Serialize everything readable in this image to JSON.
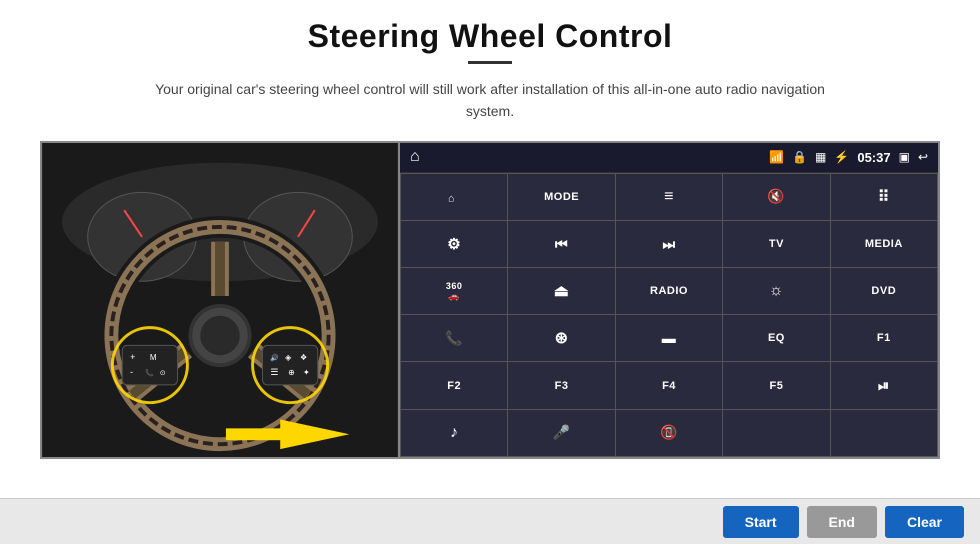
{
  "page": {
    "title": "Steering Wheel Control",
    "subtitle": "Your original car's steering wheel control will still work after installation of this all-in-one auto radio navigation system."
  },
  "topbar": {
    "time": "05:37"
  },
  "buttons": [
    {
      "id": "b1",
      "type": "icon",
      "icon": "navigate-icon",
      "symbol": "⌂"
    },
    {
      "id": "b2",
      "type": "text",
      "label": "MODE"
    },
    {
      "id": "b3",
      "type": "icon",
      "icon": "list-icon",
      "symbol": "≡"
    },
    {
      "id": "b4",
      "type": "icon",
      "icon": "mute-icon",
      "symbol": "🔇"
    },
    {
      "id": "b5",
      "type": "icon",
      "icon": "apps-icon",
      "symbol": "⠿"
    },
    {
      "id": "b6",
      "type": "icon",
      "icon": "settings-icon",
      "symbol": "⚙"
    },
    {
      "id": "b7",
      "type": "icon",
      "icon": "prev-icon",
      "symbol": "⏮"
    },
    {
      "id": "b8",
      "type": "icon",
      "icon": "next-icon",
      "symbol": "⏭"
    },
    {
      "id": "b9",
      "type": "text",
      "label": "TV"
    },
    {
      "id": "b10",
      "type": "text",
      "label": "MEDIA"
    },
    {
      "id": "b11",
      "type": "icon",
      "icon": "camera360-icon",
      "symbol": "360"
    },
    {
      "id": "b12",
      "type": "icon",
      "icon": "eject-icon",
      "symbol": "⏏"
    },
    {
      "id": "b13",
      "type": "text",
      "label": "RADIO"
    },
    {
      "id": "b14",
      "type": "icon",
      "icon": "brightness-icon",
      "symbol": "☼"
    },
    {
      "id": "b15",
      "type": "text",
      "label": "DVD"
    },
    {
      "id": "b16",
      "type": "icon",
      "icon": "phone-icon",
      "symbol": "📞"
    },
    {
      "id": "b17",
      "type": "icon",
      "icon": "navigation-icon",
      "symbol": "⊛"
    },
    {
      "id": "b18",
      "type": "icon",
      "icon": "window-icon",
      "symbol": "▬"
    },
    {
      "id": "b19",
      "type": "text",
      "label": "EQ"
    },
    {
      "id": "b20",
      "type": "text",
      "label": "F1"
    },
    {
      "id": "b21",
      "type": "text",
      "label": "F2"
    },
    {
      "id": "b22",
      "type": "text",
      "label": "F3"
    },
    {
      "id": "b23",
      "type": "text",
      "label": "F4"
    },
    {
      "id": "b24",
      "type": "text",
      "label": "F5"
    },
    {
      "id": "b25",
      "type": "icon",
      "icon": "playpause-icon",
      "symbol": "⏯"
    },
    {
      "id": "b26",
      "type": "icon",
      "icon": "music-icon",
      "symbol": "♪"
    },
    {
      "id": "b27",
      "type": "icon",
      "icon": "mic-icon",
      "symbol": "🎤"
    },
    {
      "id": "b28",
      "type": "icon",
      "icon": "hangup-icon",
      "symbol": "📵"
    },
    {
      "id": "b29",
      "type": "empty",
      "label": ""
    },
    {
      "id": "b30",
      "type": "empty",
      "label": ""
    }
  ],
  "bottom_buttons": {
    "start": "Start",
    "end": "End",
    "clear": "Clear"
  }
}
